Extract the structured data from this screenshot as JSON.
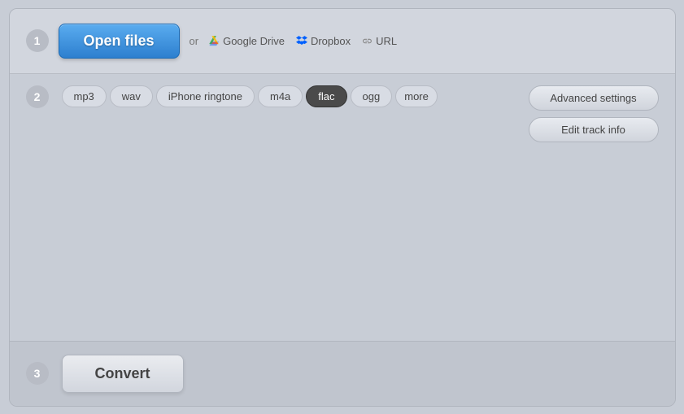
{
  "app": {
    "step1": {
      "number": "1",
      "open_files_label": "Open files",
      "or_text": "or",
      "google_drive_label": "Google Drive",
      "dropbox_label": "Dropbox",
      "url_label": "URL"
    },
    "step2": {
      "number": "2",
      "formats": [
        {
          "id": "mp3",
          "label": "mp3",
          "active": false
        },
        {
          "id": "wav",
          "label": "wav",
          "active": false
        },
        {
          "id": "iphone-ringtone",
          "label": "iPhone ringtone",
          "active": false
        },
        {
          "id": "m4a",
          "label": "m4a",
          "active": false
        },
        {
          "id": "flac",
          "label": "flac",
          "active": true
        },
        {
          "id": "ogg",
          "label": "ogg",
          "active": false
        }
      ],
      "more_label": "more",
      "advanced_settings_label": "Advanced settings",
      "edit_track_info_label": "Edit track info"
    },
    "step3": {
      "number": "3",
      "convert_label": "Convert"
    }
  }
}
